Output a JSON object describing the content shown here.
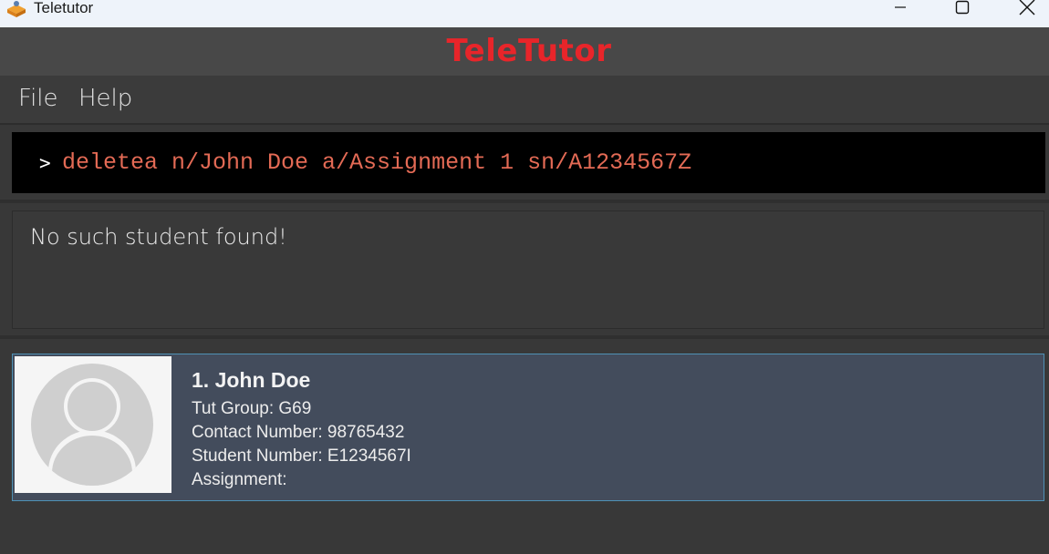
{
  "window": {
    "title": "Teletutor",
    "icon": "app-book-icon",
    "controls": [
      "minimize-icon",
      "maximize-icon",
      "close-icon"
    ]
  },
  "header": {
    "title": "TeleTutor",
    "title_color": "#e8252a"
  },
  "menu": {
    "file": "File",
    "help": "Help"
  },
  "command": {
    "prompt": ">",
    "value": "deletea n/John Doe a/Assignment 1 sn/A1234567Z",
    "text_color": "#e36a55"
  },
  "result": {
    "message": "No such student found!"
  },
  "students": [
    {
      "name": "1. John Doe",
      "tut_group": "Tut Group: G69",
      "contact": "Contact Number: 98765432",
      "student_number": "Student Number: E1234567I",
      "assignment": "Assignment:",
      "avatar": "user-avatar-icon"
    }
  ],
  "colors": {
    "background": "#383838",
    "card_background": "#434c5c",
    "card_border": "#4f91b5"
  }
}
